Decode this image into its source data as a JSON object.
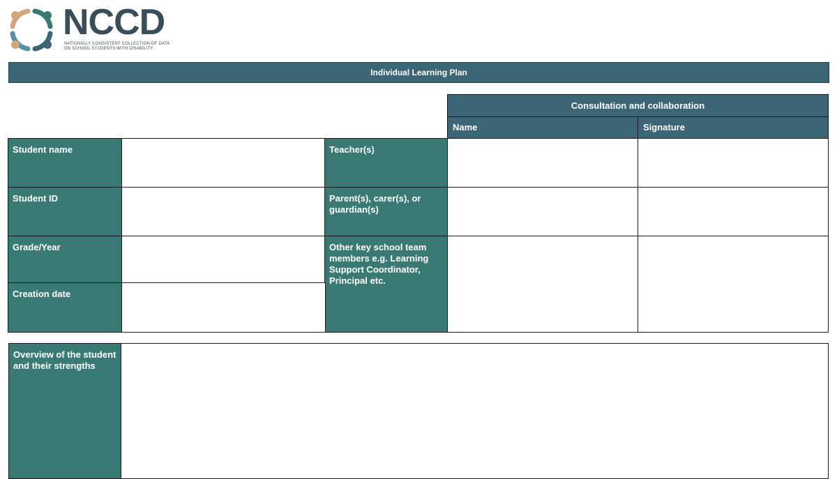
{
  "logo": {
    "word": "NCCD",
    "tagline_line1": "NATIONALLY CONSISTENT COLLECTION OF DATA",
    "tagline_line2": "ON SCHOOL STUDENTS WITH DISABILITY",
    "colors": [
      "#d4a47c",
      "#397a75",
      "#3c6575",
      "#5b8fa8"
    ]
  },
  "document": {
    "title": "Individual Learning Plan"
  },
  "consultation": {
    "header": "Consultation and collaboration",
    "col_name": "Name",
    "col_signature": "Signature"
  },
  "student_fields": {
    "student_name": "Student name",
    "student_id": "Student ID",
    "grade_year": "Grade/Year",
    "creation_date": "Creation date"
  },
  "team_fields": {
    "teachers": "Teacher(s)",
    "parents": "Parent(s), carer(s), or guardian(s)",
    "other_members": "Other key school team members e.g. Learning Support Coordinator, Principal etc."
  },
  "overview": {
    "label": "Overview of the student and their strengths"
  },
  "colors": {
    "header_blue": "#3c6575",
    "label_teal": "#397a75"
  }
}
